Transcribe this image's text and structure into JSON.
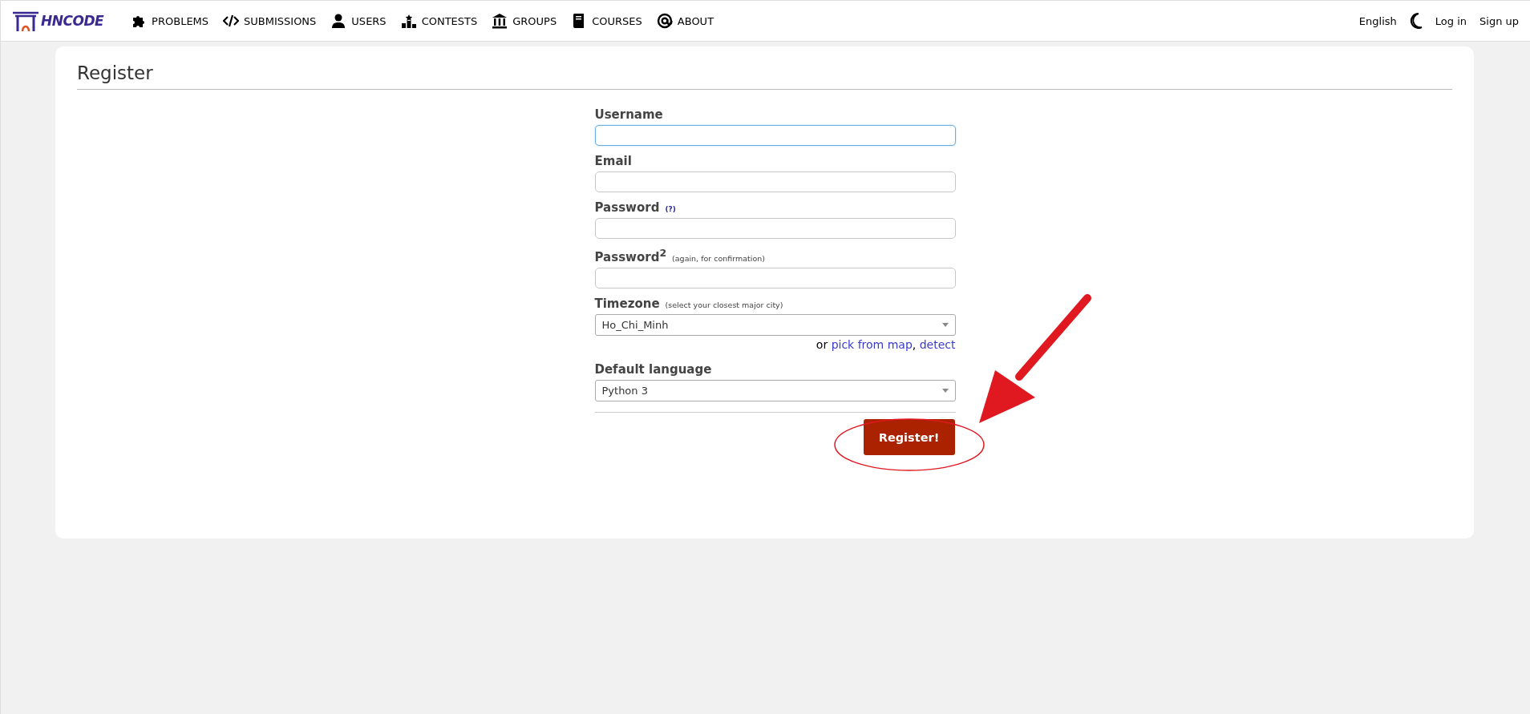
{
  "header": {
    "logo_text": "HNCODE",
    "nav": [
      {
        "label": "PROBLEMS",
        "kind": "puzzle"
      },
      {
        "label": "SUBMISSIONS",
        "kind": "code"
      },
      {
        "label": "USERS",
        "kind": "user"
      },
      {
        "label": "CONTESTS",
        "kind": "podium"
      },
      {
        "label": "GROUPS",
        "kind": "bank"
      },
      {
        "label": "COURSES",
        "kind": "book"
      },
      {
        "label": "ABOUT",
        "kind": "at"
      }
    ],
    "language": "English",
    "login": "Log in",
    "signup": "Sign up"
  },
  "page": {
    "title": "Register",
    "fields": [
      {
        "kind": "text",
        "label": "Username",
        "focused": true
      },
      {
        "kind": "text",
        "label": "Email",
        "focused": false
      },
      {
        "kind": "text",
        "label": "Password",
        "help_link": "(?)",
        "focused": false
      },
      {
        "kind": "text",
        "label": "Password$^{2}$",
        "hint": "(again, for confirmation)",
        "focused": false
      },
      {
        "kind": "select",
        "label": "Timezone",
        "hint": "(select your closest major city)",
        "value": "Ho_Chi_Minh",
        "links": {
          "prefix": "or",
          "separator": ",",
          "items": [
            "pick from map",
            "detect"
          ]
        }
      },
      {
        "kind": "select",
        "label": "Default language",
        "value": "Python 3"
      }
    ],
    "submit": "Register!"
  },
  "annotation": {
    "highlight_ring": true,
    "arrow": true
  }
}
